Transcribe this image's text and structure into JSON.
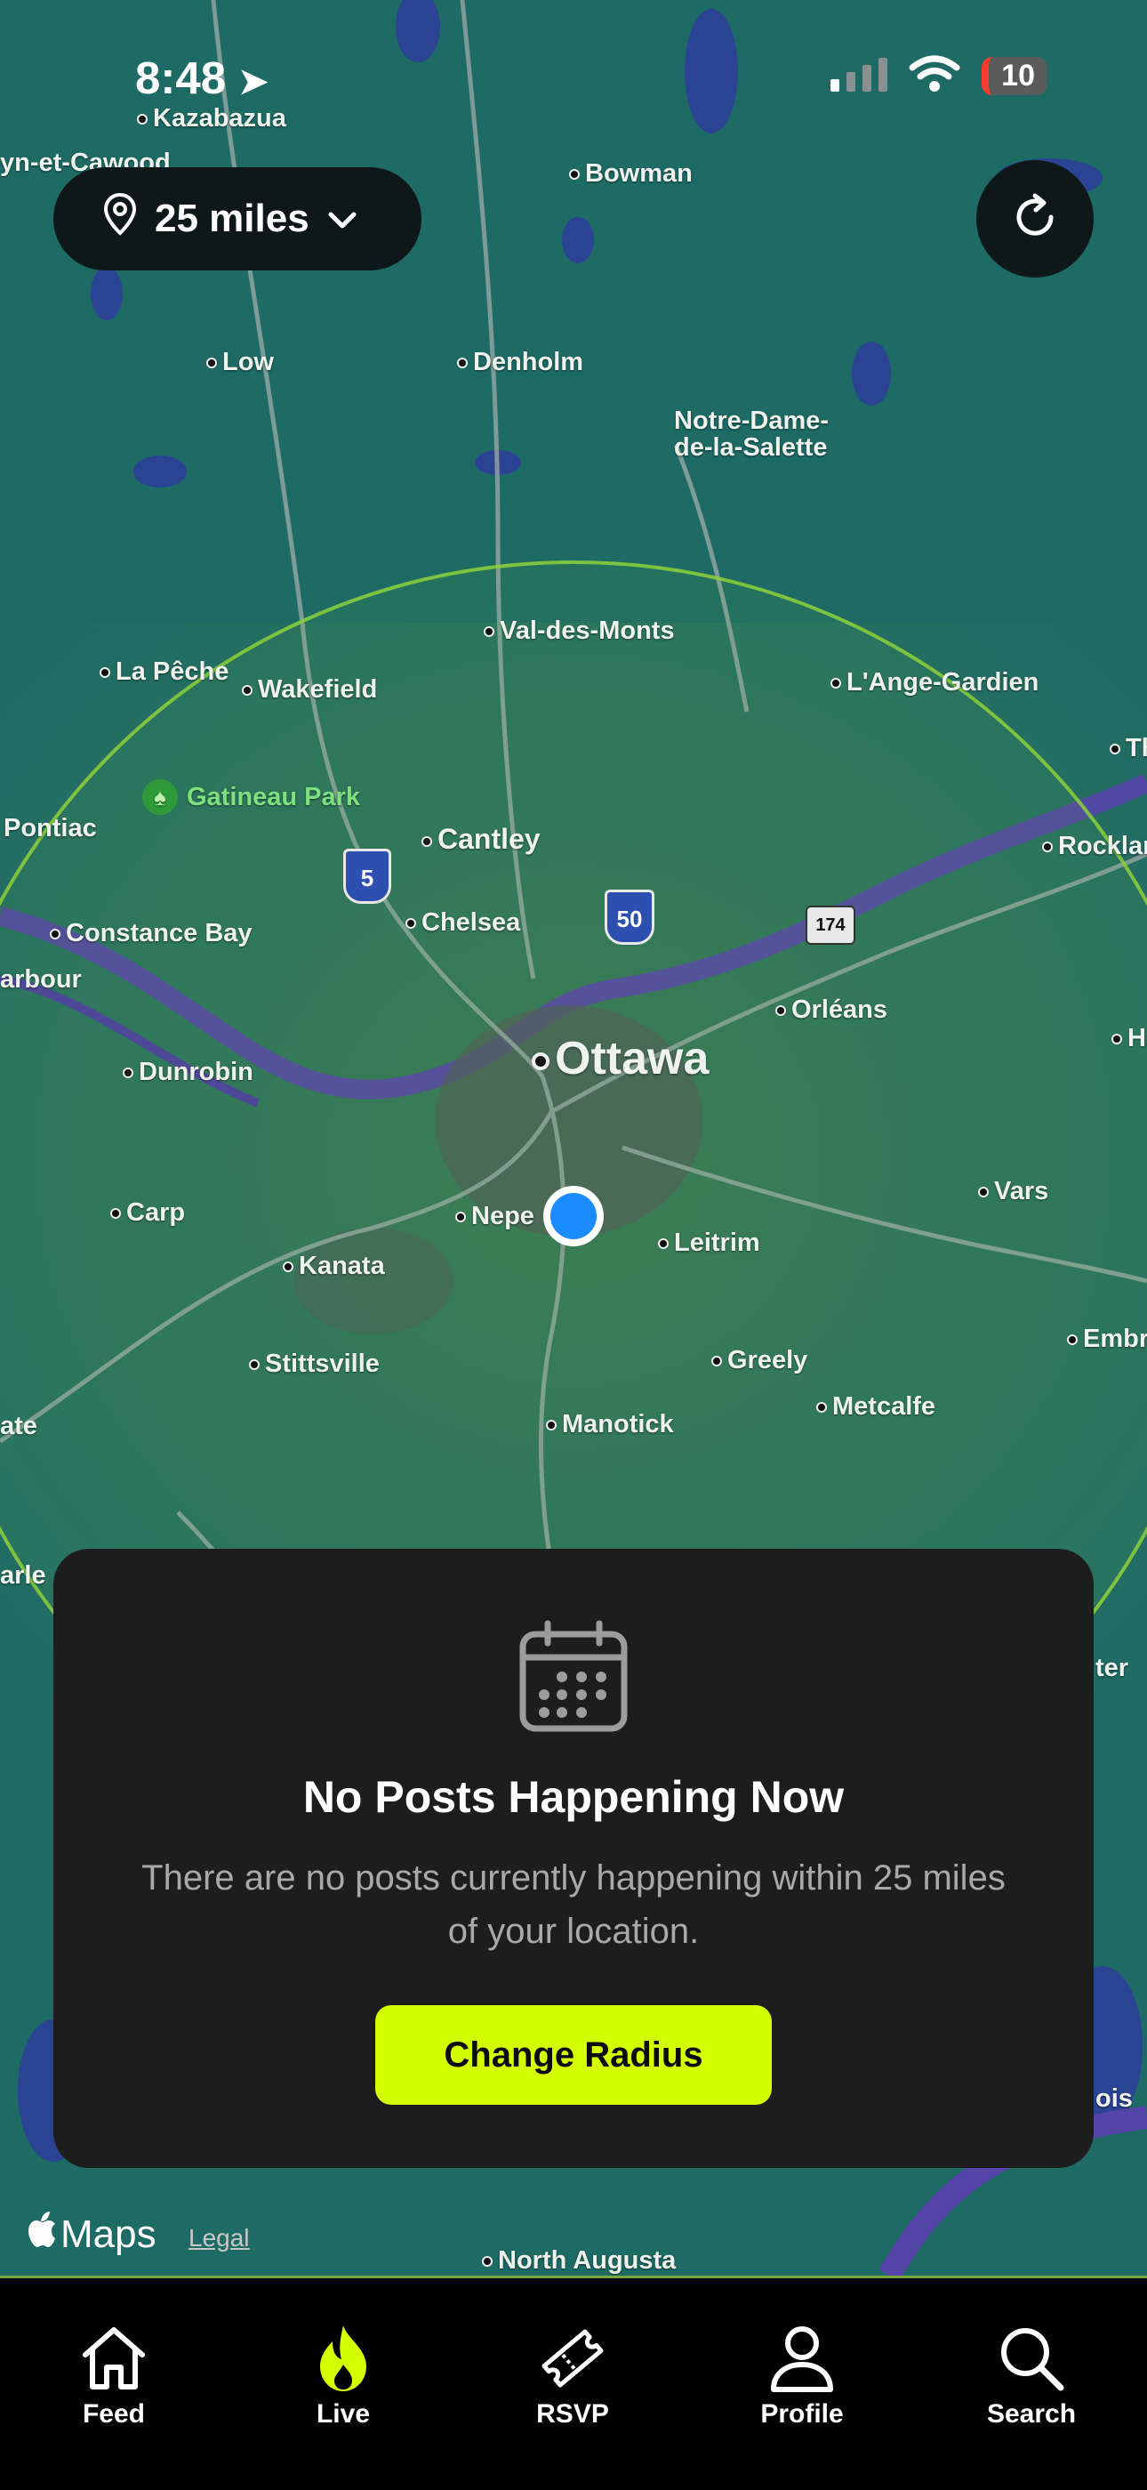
{
  "status_bar": {
    "time": "8:48",
    "battery": "10"
  },
  "radius_selector": {
    "label": "25 miles"
  },
  "map": {
    "labels": {
      "kazabazua": "Kazabazua",
      "cawood": "yn-et-Cawood",
      "bowman": "Bowman",
      "low": "Low",
      "denholm": "Denholm",
      "notre_dame": "Notre-Dame-\nde-la-Salette",
      "val_des_monts": "Val-des-Monts",
      "la_peche": "La Pêche",
      "wakefield": "Wakefield",
      "lange_gardien": "L'Ange-Gardien",
      "gatineau_park": "Gatineau Park",
      "pontiac": "Pontiac",
      "cantley": "Cantley",
      "constance_bay": "Constance Bay",
      "chelsea": "Chelsea",
      "arbour": "arbour",
      "orleans": "Orléans",
      "dunrobin": "Dunrobin",
      "ottawa": "Ottawa",
      "carp": "Carp",
      "nepean": "Nepe",
      "leitrim": "Leitrim",
      "vars": "Vars",
      "kanata": "Kanata",
      "stittsville": "Stittsville",
      "greely": "Greely",
      "metcalfe": "Metcalfe",
      "manotick": "Manotick",
      "ate": "ate",
      "embr": "Embr",
      "arle": "arle",
      "ter": "ter",
      "ois": "ois",
      "north_augusta": "North Augusta",
      "th": "Th",
      "rocklar": "Rocklar",
      "ha": "Ha"
    },
    "shields": {
      "hwy5": "5",
      "hwy50": "50",
      "hwy174": "174"
    }
  },
  "empty_state": {
    "title": "No Posts Happening Now",
    "message": "There are no posts currently happening within 25 miles of your location.",
    "cta": "Change Radius"
  },
  "map_attribution": {
    "brand": "Maps",
    "legal": "Legal"
  },
  "tabs": [
    {
      "label": "Feed",
      "icon": "home-icon",
      "active": false
    },
    {
      "label": "Live",
      "icon": "flame-icon",
      "active": true
    },
    {
      "label": "RSVP",
      "icon": "ticket-icon",
      "active": false
    },
    {
      "label": "Profile",
      "icon": "person-icon",
      "active": false
    },
    {
      "label": "Search",
      "icon": "search-icon",
      "active": false
    }
  ],
  "colors": {
    "accent": "#D4FF00",
    "map_water": "#2a3f9a",
    "map_land": "#1f6b63",
    "card_bg": "#1D1D1D",
    "radius_ring": "#8ed13a"
  }
}
